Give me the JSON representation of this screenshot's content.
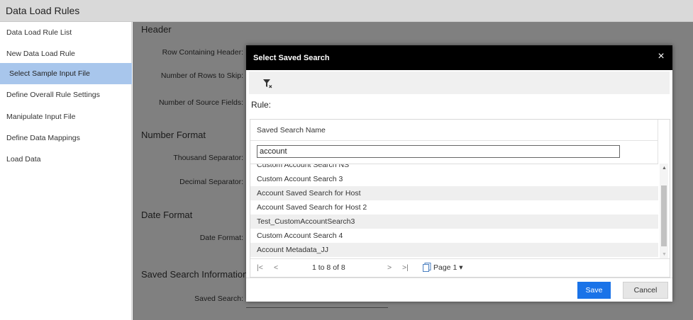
{
  "app": {
    "title": "Data Load Rules"
  },
  "sidebar": {
    "items": [
      {
        "label": "Data Load Rule List",
        "active": false
      },
      {
        "label": "New Data Load Rule",
        "active": false
      },
      {
        "label": "Select Sample Input File",
        "active": true
      },
      {
        "label": "Define Overall Rule Settings",
        "active": false
      },
      {
        "label": "Manipulate Input File",
        "active": false
      },
      {
        "label": "Define Data Mappings",
        "active": false
      },
      {
        "label": "Load Data",
        "active": false
      }
    ]
  },
  "form": {
    "header_section": "Header",
    "row_containing_header": "Row Containing Header:",
    "rows_to_skip": "Number of Rows to Skip:",
    "source_fields": "Number of Source Fields:",
    "number_format_section": "Number Format",
    "thousand_separator": "Thousand Separator:",
    "decimal_separator": "Decimal Separator:",
    "date_format_section": "Date Format",
    "date_format": "Date Format:",
    "saved_search_section": "Saved Search Information",
    "saved_search": "Saved Search:"
  },
  "modal": {
    "title": "Select Saved Search",
    "close": "×",
    "rule_label": "Rule:",
    "column_header": "Saved Search Name",
    "filter_value": "account",
    "rows": [
      "Custom Account Search NS",
      "Custom Account Search 3",
      "Account Saved Search for Host",
      "Account Saved Search for Host 2",
      "Test_CustomAccountSearch3",
      "Custom Account Search 4",
      "Account Metadata_JJ"
    ],
    "pager": {
      "first": "|<",
      "prev": "<",
      "info": "1 to 8 of 8",
      "next": ">",
      "last": ">|",
      "page": "Page 1 ▾"
    },
    "save_label": "Save",
    "cancel_label": "Cancel"
  },
  "colors": {
    "accent": "#1a73e8",
    "sidebar_active": "#a8c6ec",
    "modal_header": "#000000",
    "overlay": "#808080"
  }
}
